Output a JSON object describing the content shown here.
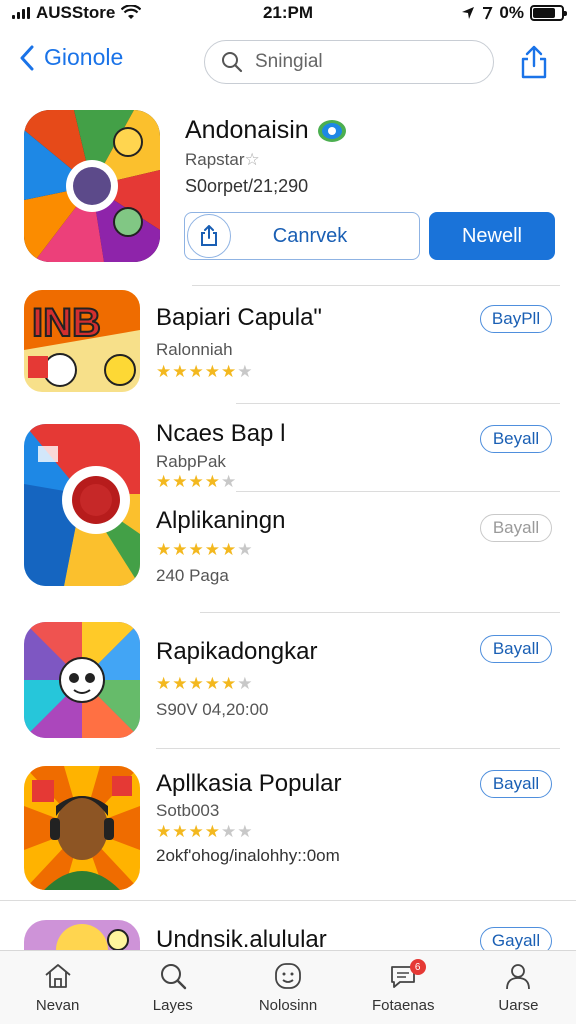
{
  "status": {
    "carrier": "AUSStore",
    "time": "21:PM",
    "battery": "0%"
  },
  "nav": {
    "back_label": "Gionole",
    "search_placeholder": "Sningial"
  },
  "featured": {
    "title": "Andonaisin",
    "subtitle": "Rapstar",
    "meta": "S0orpet/21;290",
    "secondary_label": "Canrvek",
    "primary_label": "Newell"
  },
  "apps": [
    {
      "title": "Bapiari Capula\"",
      "subtitle": "Ralonniah",
      "rating": 4.5,
      "button": "BayPll"
    },
    {
      "title": "Ncaes Bap l",
      "subtitle": "RabpPak",
      "rating": 4,
      "button": "Beyall"
    },
    {
      "title": "Alplikaningn",
      "subtitle": "240 Paga",
      "rating": 4.5,
      "button": "Bayall"
    },
    {
      "title": "Rapikadongkar",
      "subtitle": "S90V 04,20:00",
      "rating": 4.5,
      "button": "Bayall"
    },
    {
      "title": "Apllkasia Popular",
      "subtitle": "Sotb003",
      "meta": "2okf'ohog/inalohhy::0om",
      "rating": 3.5,
      "button": "Bayall"
    },
    {
      "title": "Undnsik.alulular",
      "button": "Gayall"
    }
  ],
  "tabs": [
    {
      "label": "Nevan",
      "icon": "home-icon"
    },
    {
      "label": "Layes",
      "icon": "search-icon"
    },
    {
      "label": "Nolosinn",
      "icon": "smiley-icon"
    },
    {
      "label": "Fotaenas",
      "icon": "notification-icon",
      "badge": "6"
    },
    {
      "label": "Uarse",
      "icon": "profile-icon"
    }
  ],
  "colors": {
    "accent": "#1a73d9",
    "star": "#f3b81f",
    "badge": "#e53935"
  }
}
